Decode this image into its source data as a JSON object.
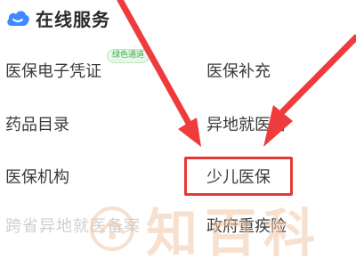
{
  "header": {
    "icon": "cloud-icon",
    "title": "在线服务"
  },
  "services": {
    "left": [
      "医保电子凭证",
      "药品目录",
      "医保机构",
      "跨省异地就医备案"
    ],
    "right": [
      "医保补充",
      "异地就医备",
      "少儿医保",
      "政府重疾险"
    ]
  },
  "badge": {
    "text": "绿色通道"
  },
  "watermark": {
    "text": "知百科"
  },
  "colors": {
    "accent_blue": "#3d8bff",
    "highlight_red": "#e53935",
    "badge_green": "#3db14a",
    "watermark_orange": "#f4c7a8"
  }
}
